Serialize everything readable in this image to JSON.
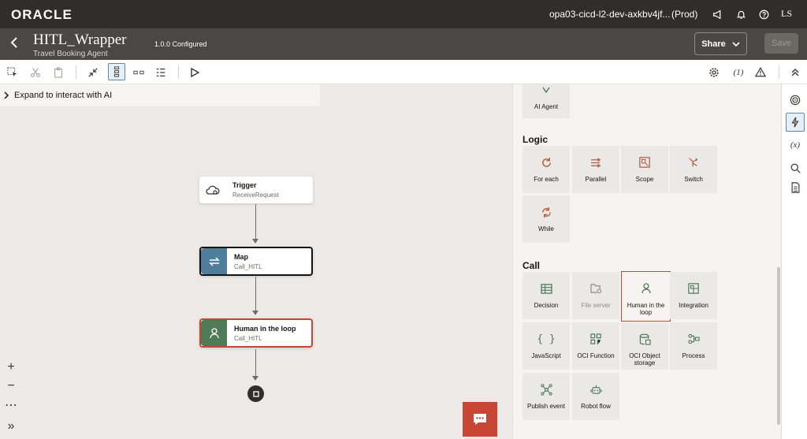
{
  "brand": {
    "logo": "ORACLE"
  },
  "topbar": {
    "env_name": "opa03-cicd-l2-dev-axkbv4jf...",
    "env_tag": "(Prod)",
    "user": "LS"
  },
  "header": {
    "title": "HITL_Wrapper",
    "version": "1.0.0 Configured",
    "subtitle": "Travel Booking Agent",
    "share_label": "Share",
    "save_label": "Save"
  },
  "toolbar": {
    "variable_icon_label": "(1)"
  },
  "canvas": {
    "expand_label": "Expand to interact with AI",
    "nodes": [
      {
        "title": "Trigger",
        "subtitle": "ReceiveRequest"
      },
      {
        "title": "Map",
        "subtitle": "Call_HITL"
      },
      {
        "title": "Human in the loop",
        "subtitle": "Call_HITL"
      }
    ],
    "zoom": {
      "plus": "+",
      "minus": "−",
      "more": "⋯",
      "expand": "»"
    }
  },
  "palette": {
    "ai_agent_label": "AI Agent",
    "logic_title": "Logic",
    "logic_items": [
      "For each",
      "Parallel",
      "Scope",
      "Switch",
      "While"
    ],
    "call_title": "Call",
    "call_items": [
      "Decision",
      "File server",
      "Human in the loop",
      "Integration",
      "JavaScript",
      "OCI Function",
      "OCI Object storage",
      "Process",
      "Publish event",
      "Robot flow"
    ]
  },
  "rail": {
    "variables_label": "(x)"
  },
  "colors": {
    "accent": "#c74634",
    "topbar": "#312d2a",
    "header": "#4b4744",
    "map_node": "#4f7d9c",
    "hitl_node": "#4e7a57"
  }
}
